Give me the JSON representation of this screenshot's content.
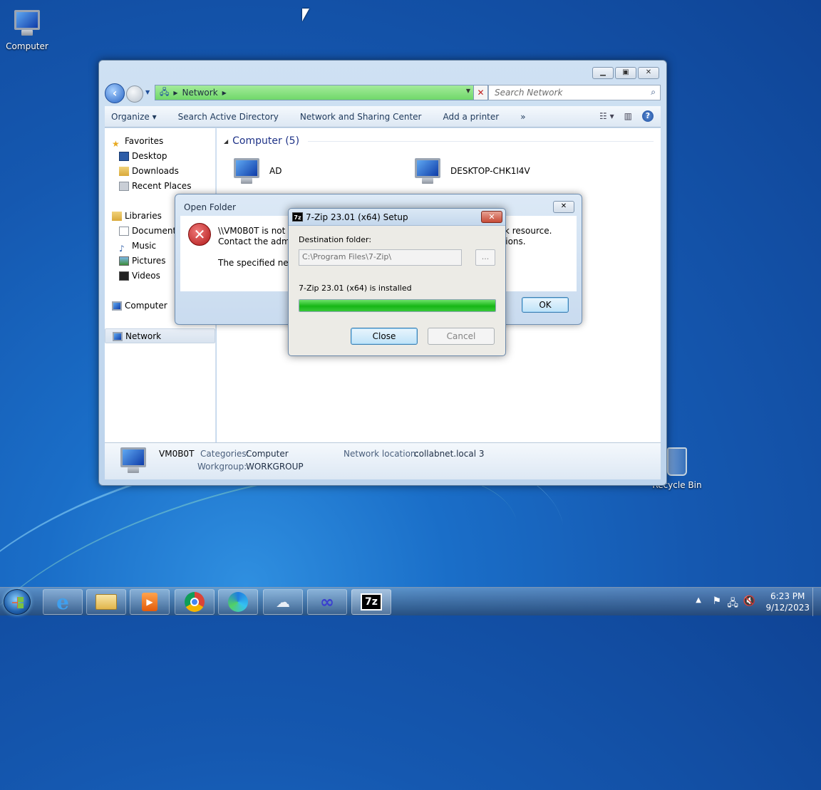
{
  "desktop": {
    "icons": [
      {
        "label": "Computer",
        "icon": "computer-icon"
      },
      {
        "label": "Recycle Bin",
        "icon": "recycle-bin-icon"
      }
    ]
  },
  "explorer": {
    "address_path": "Network",
    "search_placeholder": "Search Network",
    "toolbar": [
      "Organize",
      "Search Active Directory",
      "Network and Sharing Center",
      "Add a printer",
      "»"
    ],
    "nav": {
      "favorites": "Favorites",
      "favorites_items": [
        "Desktop",
        "Downloads",
        "Recent Places"
      ],
      "libraries": "Libraries",
      "libraries_items": [
        "Documents",
        "Music",
        "Pictures",
        "Videos"
      ],
      "computer": "Computer",
      "network": "Network"
    },
    "group_header": "Computer (5)",
    "items": [
      "AD",
      "DESKTOP-CHK1I4V"
    ],
    "details": {
      "name": "VM0B0T",
      "categories_label": "Categories:",
      "categories_value": "Computer",
      "workgroup_label": "Workgroup:",
      "workgroup_value": "WORKGROUP",
      "network_location_label": "Network location:",
      "network_location_value": "collabnet.local  3"
    }
  },
  "open_folder_dialog": {
    "title": "Open Folder",
    "line1_left": "\\\\VM0B0T is not ac",
    "line1_right": "rk resource.",
    "line2_left": "Contact the admin",
    "line2_right": "sions.",
    "line3": "The specified netw",
    "ok_label": "OK"
  },
  "zip_setup": {
    "title": "7-Zip 23.01 (x64) Setup",
    "icon_text": "7z",
    "dest_label": "Destination folder:",
    "dest_value": "C:\\Program Files\\7-Zip\\",
    "browse_label": "...",
    "status": "7-Zip 23.01 (x64) is installed",
    "progress": 1.0,
    "close_label": "Close",
    "cancel_label": "Cancel"
  },
  "taskbar": {
    "apps": [
      "internet-explorer",
      "file-explorer",
      "media-player",
      "chrome",
      "edge",
      "app-cloud",
      "app-infinity",
      "7-zip"
    ],
    "zip_text": "7z",
    "time": "6:23 PM",
    "date": "9/12/2023"
  },
  "colors": {
    "accent": "#1e3287",
    "progress_green": "#16b716",
    "error_red": "#b01818"
  }
}
